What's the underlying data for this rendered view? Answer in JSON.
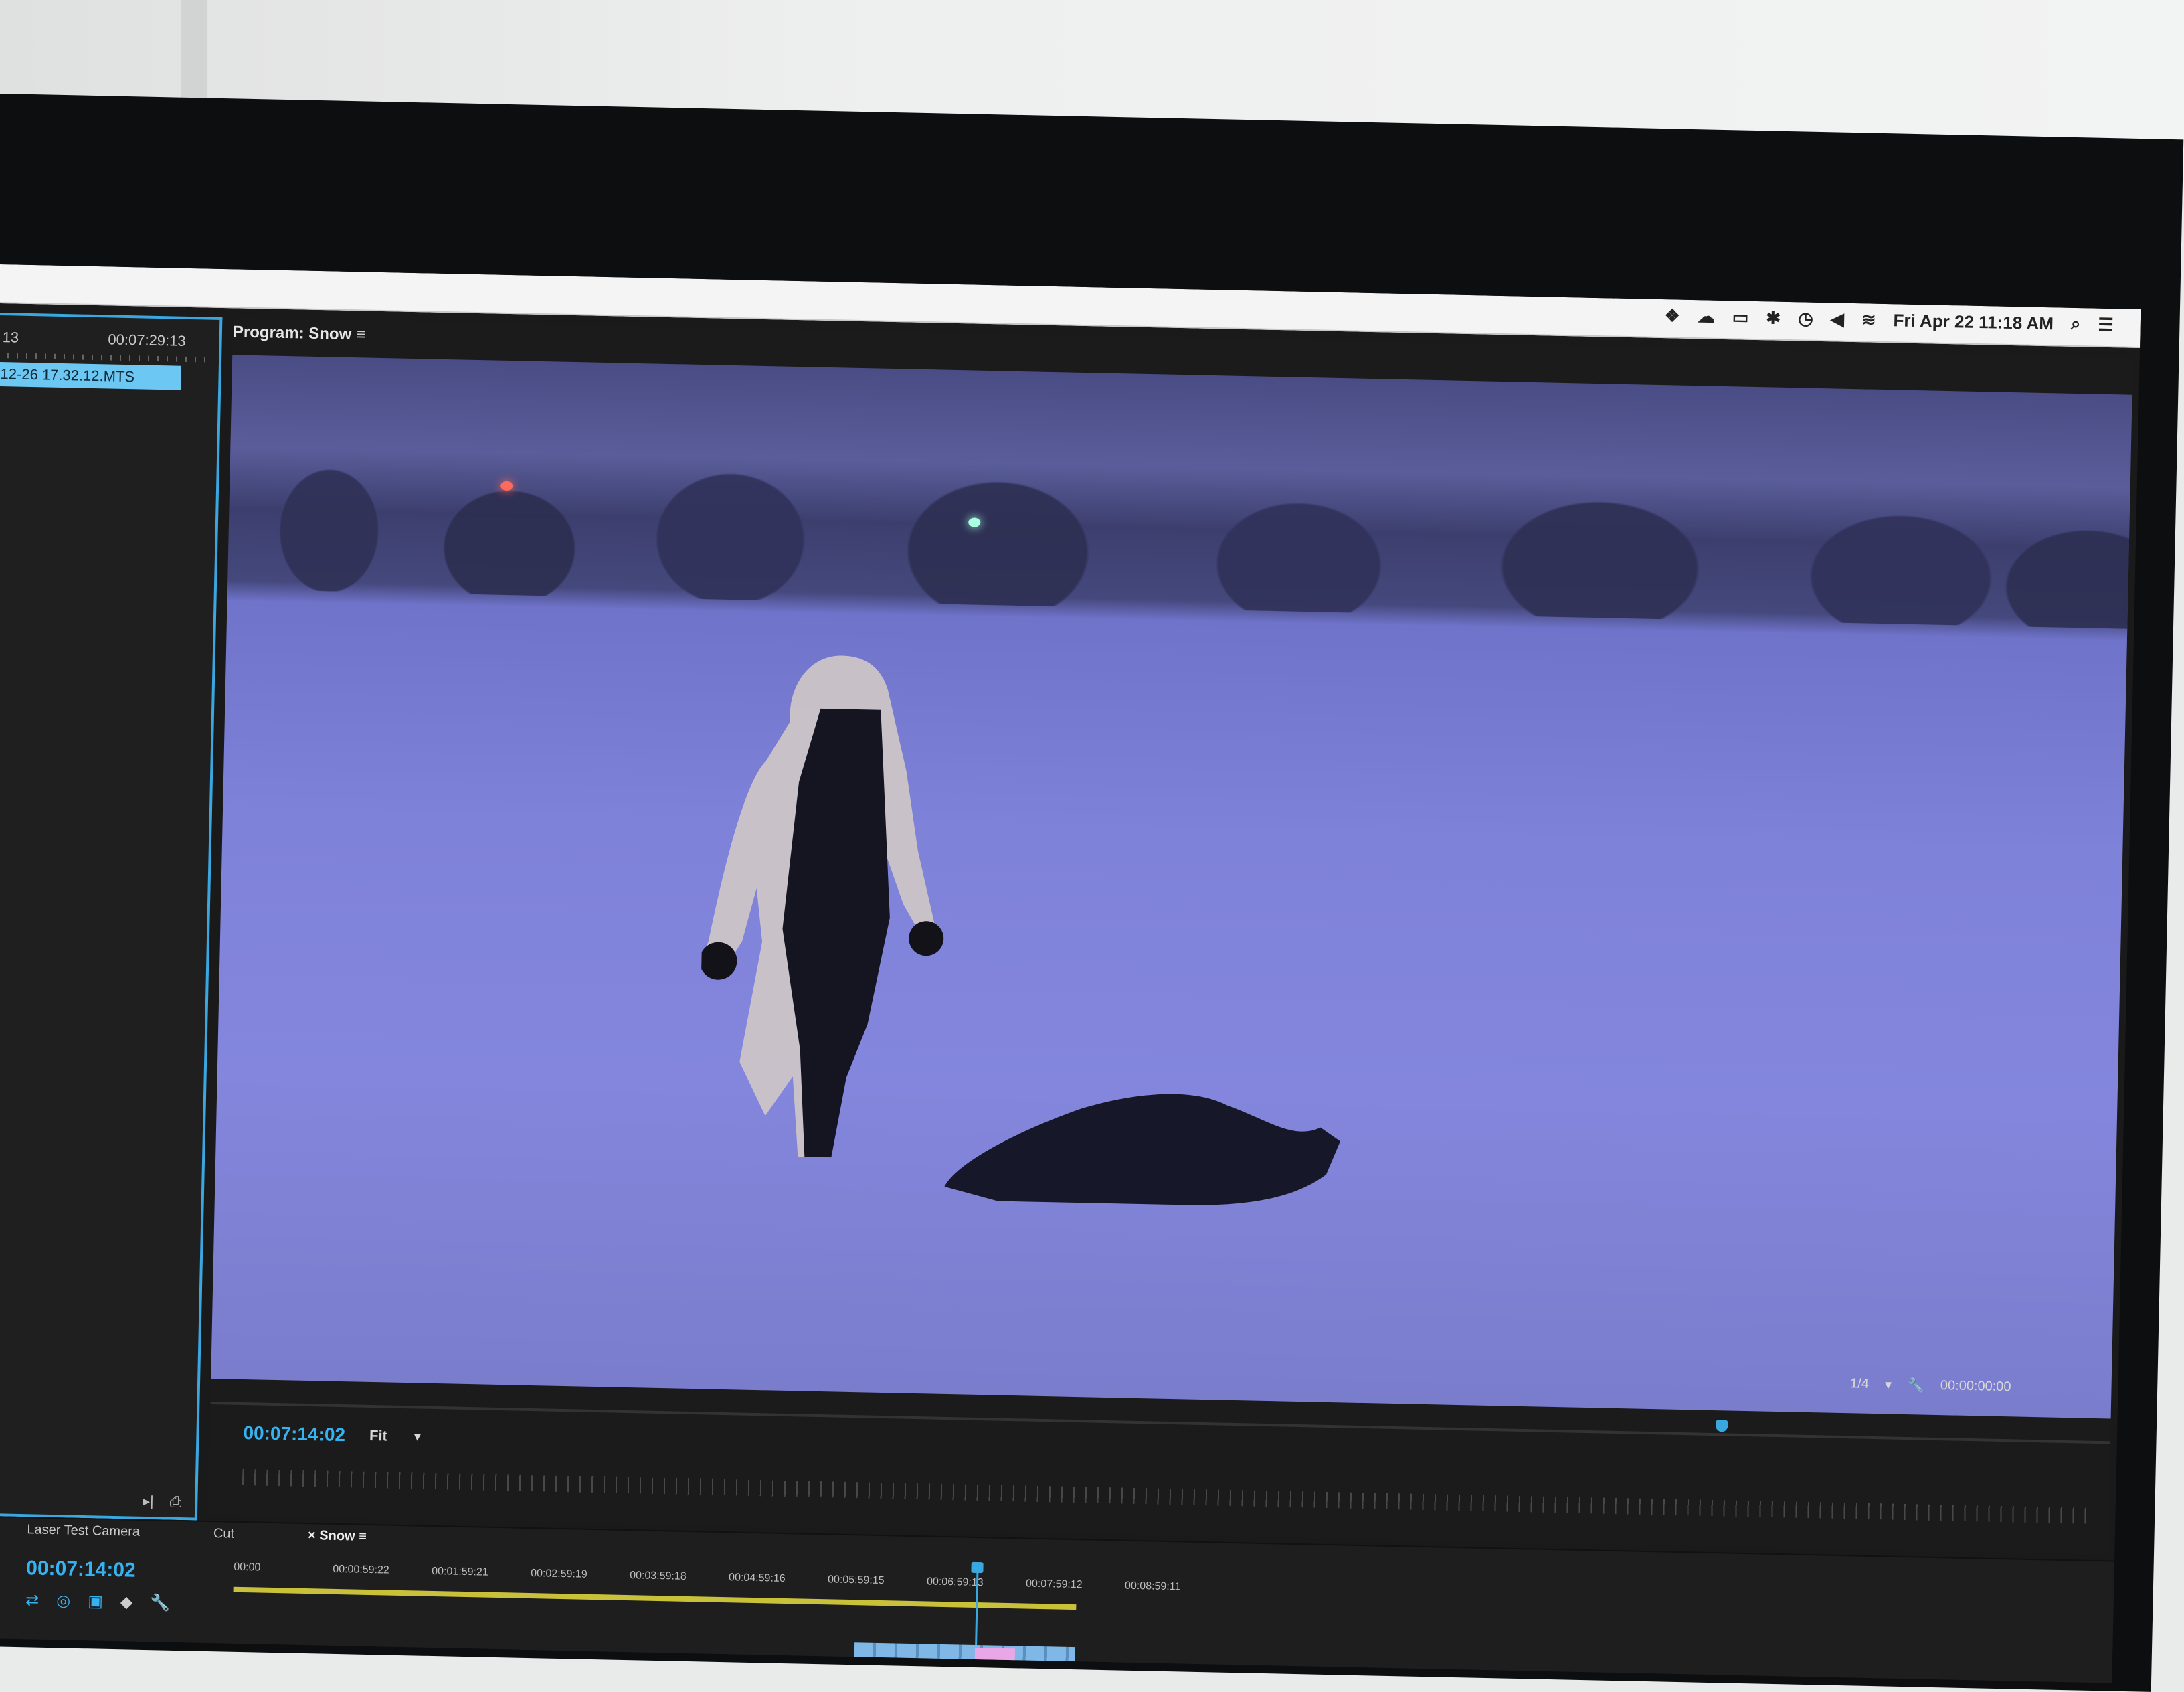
{
  "menubar": {
    "icons": [
      "dropbox-icon",
      "cloud-icon",
      "display-icon",
      "bluetooth-icon",
      "time-machine-icon",
      "volume-icon",
      "wifi-icon"
    ],
    "clock": "Fri Apr 22 11:18 AM",
    "search_icon": "search-icon",
    "list_icon": "list-icon"
  },
  "source": {
    "tc_left": "13",
    "tc_right": "00:07:29:13",
    "clip": "12-26 17.32.12.MTS"
  },
  "program": {
    "title": "Program: Snow",
    "menu": "≡",
    "timecode": "00:07:14:02",
    "fit": "Fit",
    "quality": "1/4",
    "duration": "00:00:00:00"
  },
  "timeline": {
    "tabs": [
      "Laser Test Camera",
      "Cut",
      "Snow"
    ],
    "tab_close": "×",
    "tab_menu": "≡",
    "timecode": "00:07:14:02",
    "ruler": [
      "00:00",
      "00:00:59:22",
      "00:01:59:21",
      "00:02:59:19",
      "00:03:59:18",
      "00:04:59:16",
      "00:05:59:15",
      "00:06:59:13",
      "00:07:59:12",
      "00:08:59:11"
    ]
  },
  "colors": {
    "accent": "#37b2f0",
    "workbar": "#c9c13a",
    "video_tint": "#7e82d8"
  }
}
